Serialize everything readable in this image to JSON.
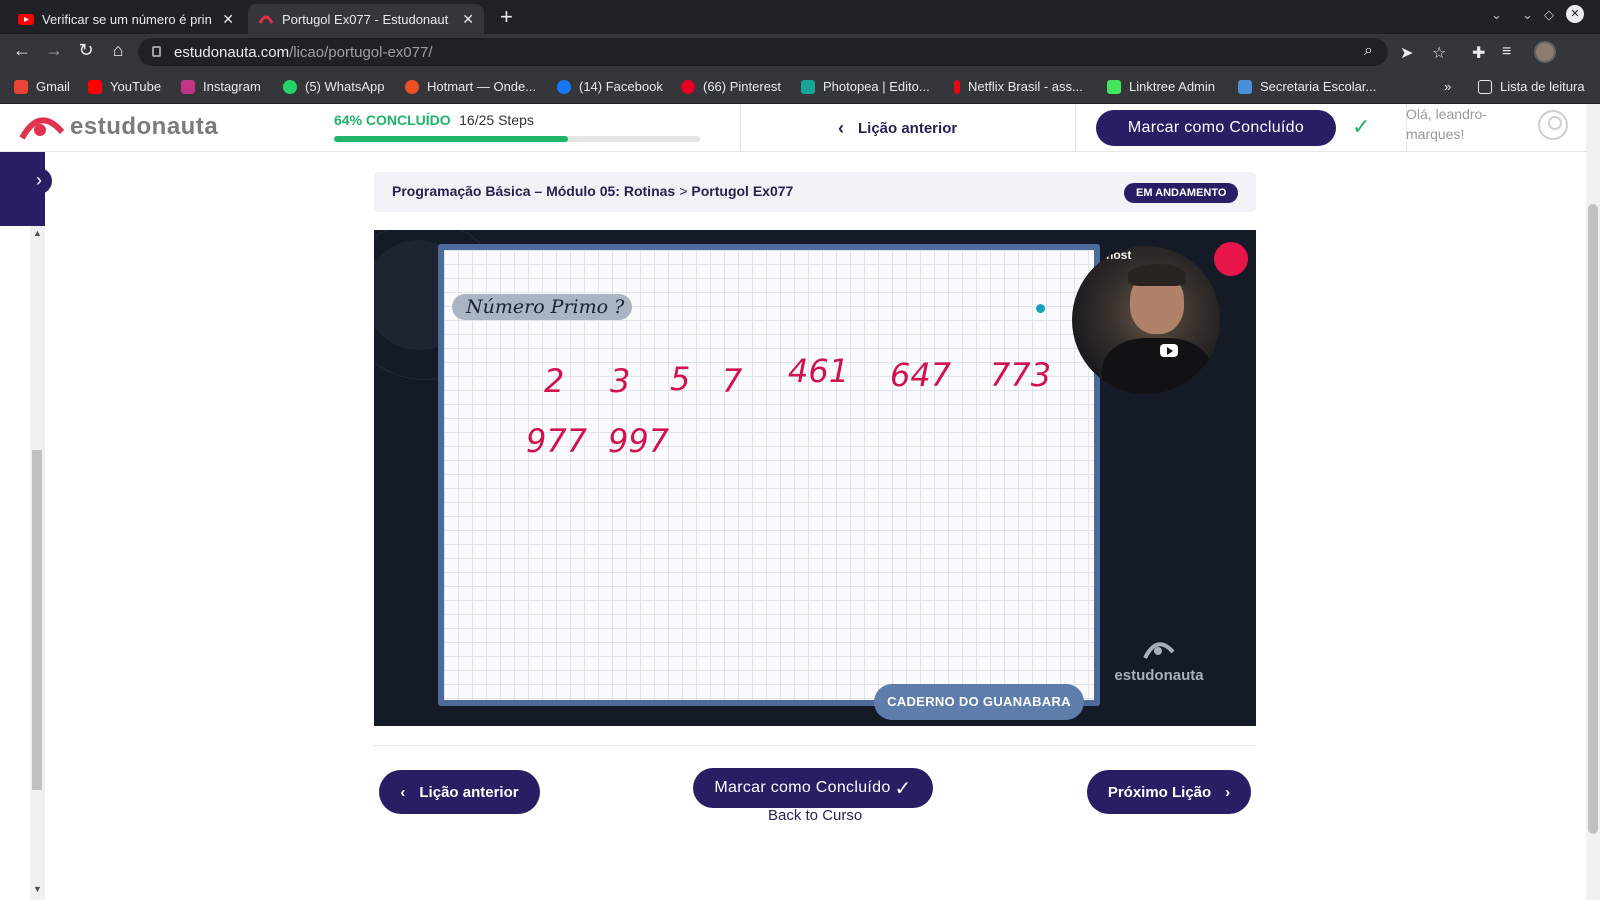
{
  "browser": {
    "tabs": [
      {
        "title": "Verificar se um número é prin",
        "icon": "youtube-icon"
      },
      {
        "title": "Portugol Ex077 - Estudonaut",
        "icon": "estudonauta-icon"
      }
    ],
    "url_host": "estudonauta.com",
    "url_path": "/licao/portugol-ex077/",
    "bookmarks": [
      {
        "label": "Gmail",
        "color": "#ea4335"
      },
      {
        "label": "YouTube",
        "color": "#ff0000"
      },
      {
        "label": "Instagram",
        "color": "#c13584"
      },
      {
        "label": "(5) WhatsApp",
        "color": "#25d366"
      },
      {
        "label": "Hotmart — Onde...",
        "color": "#f04e23"
      },
      {
        "label": "(14) Facebook",
        "color": "#1877f2"
      },
      {
        "label": "(66) Pinterest",
        "color": "#e60023"
      },
      {
        "label": "Photopea | Edito...",
        "color": "#18a497"
      },
      {
        "label": "Netflix Brasil - ass...",
        "color": "#e50914"
      },
      {
        "label": "Linktree Admin",
        "color": "#43e55e"
      },
      {
        "label": "Secretaria Escolar...",
        "color": "#4a90d9"
      }
    ],
    "more_label": "»",
    "reading_list": "Lista de leitura"
  },
  "header": {
    "logo": "estudonauta",
    "progress_label": "64% CONCLUÍDO",
    "progress_value": 0.64,
    "steps_label": "16/25 Steps",
    "prev_lesson": "Lição anterior",
    "mark_complete": "Marcar como Concluído",
    "greeting": "Olá, leandro-marques!"
  },
  "breadcrumb": {
    "course": "Programação Básica – Módulo 05: Rotinas",
    "separator": ">",
    "lesson": "Portugol Ex077",
    "status": "EM ANDAMENTO"
  },
  "video": {
    "board_title": "Número Primo ?",
    "numbers": [
      "2",
      "3",
      "5",
      "7",
      "461",
      "647",
      "773",
      "977",
      "997"
    ],
    "caderno_label": "CADERNO DO GUANABARA",
    "webcam_text": "host",
    "watermark": "estudonauta"
  },
  "footer": {
    "prev_button": "Lição anterior",
    "mark_button": "Marcar como Concluído",
    "next_button": "Próximo Lição",
    "back_link": "Back to Curso"
  },
  "colors": {
    "brand_purple": "#291d64",
    "progress_green": "#1fb36b",
    "ink_red": "#d0134f"
  }
}
